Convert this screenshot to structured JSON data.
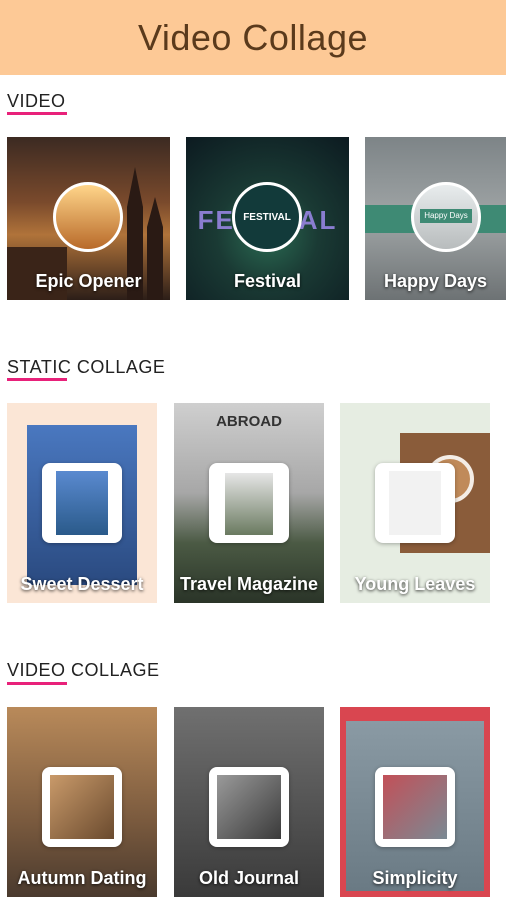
{
  "header": {
    "title": "Video Collage"
  },
  "sections": {
    "video": {
      "title": "VIDEO",
      "items": [
        {
          "label": "Epic Opener"
        },
        {
          "label": "Festival",
          "overlay": "FESTIVAL"
        },
        {
          "label": "Happy Days",
          "overlay": "Happy Days"
        }
      ]
    },
    "static": {
      "title": "STATIC COLLAGE",
      "items": [
        {
          "label": "Sweet Dessert"
        },
        {
          "label": "Travel Magazine",
          "overlay": "ABROAD"
        },
        {
          "label": "Young Leaves"
        }
      ]
    },
    "collage": {
      "title": "VIDEO COLLAGE",
      "items": [
        {
          "label": "Autumn Dating"
        },
        {
          "label": "Old Journal"
        },
        {
          "label": "Simplicity"
        }
      ]
    }
  },
  "colors": {
    "header_bg": "#fdc996",
    "accent": "#e8217a",
    "title_text": "#5a3a1c"
  }
}
